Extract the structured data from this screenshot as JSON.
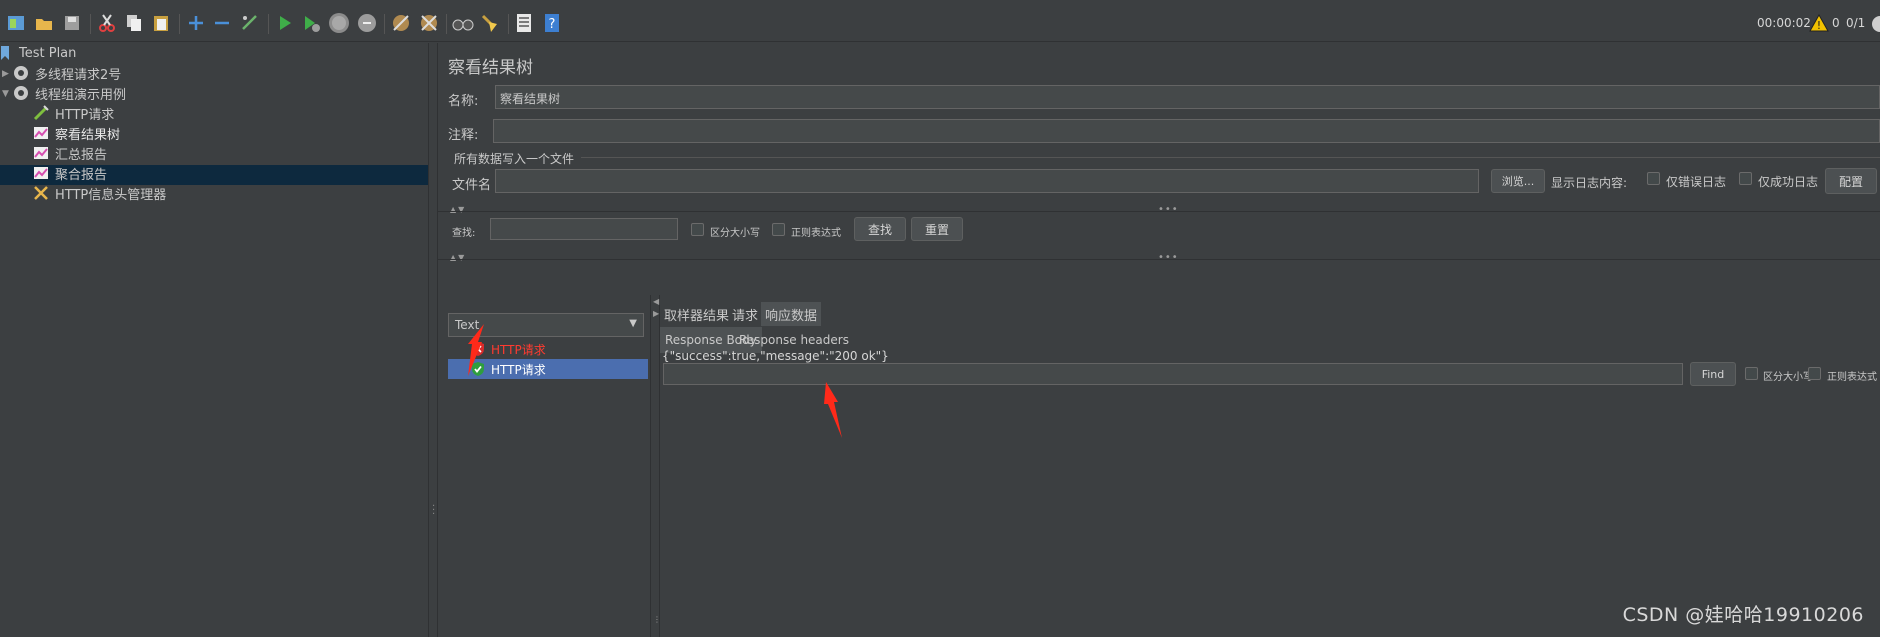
{
  "toolbar": {
    "timer": "00:00:02",
    "warning_count": "0",
    "threads": "0/1"
  },
  "tree": {
    "items": [
      {
        "label": "Test Plan",
        "icon": "test-plan-icon"
      },
      {
        "label": "多线程请求2号",
        "icon": "gear-icon"
      },
      {
        "label": "线程组演示用例",
        "icon": "gear-icon"
      },
      {
        "label": "HTTP请求",
        "icon": "pipette-icon"
      },
      {
        "label": "察看结果树",
        "icon": "chart-icon"
      },
      {
        "label": "汇总报告",
        "icon": "chart-icon"
      },
      {
        "label": "聚合报告",
        "icon": "chart-icon"
      },
      {
        "label": "HTTP信息头管理器",
        "icon": "wrench-icon"
      }
    ]
  },
  "panel": {
    "title": "察看结果树",
    "name_label": "名称:",
    "name_value": "察看结果树",
    "comment_label": "注释:",
    "comment_value": "",
    "write_all_label": "所有数据写入一个文件",
    "filename_label": "文件名",
    "filename_value": "",
    "browse_button": "浏览...",
    "log_content_label": "显示日志内容:",
    "errors_only_label": "仅错误日志",
    "success_only_label": "仅成功日志",
    "config_button": "配置"
  },
  "search": {
    "label": "查找:",
    "value": "",
    "case_sensitive_label": "区分大小写",
    "regex_label": "正则表达式",
    "find_button": "查找",
    "reset_button": "重置"
  },
  "results": {
    "renderer": "Text",
    "items": [
      {
        "label": "HTTP请求",
        "status": "fail"
      },
      {
        "label": "HTTP请求",
        "status": "success"
      }
    ]
  },
  "detail": {
    "tabs": [
      "取样器结果",
      "请求",
      "响应数据"
    ],
    "active_tab": "响应数据",
    "subtabs": [
      "Response Body",
      "Response headers"
    ],
    "active_subtab": "Response Body",
    "find_value": "",
    "find_button": "Find",
    "case_sensitive_label": "区分大小写",
    "regex_label": "正则表达式",
    "body": "{\"success\":true,\"message\":\"200 ok\"}"
  },
  "watermark": "CSDN @娃哈哈19910206",
  "colors": {
    "background": "#3c3f41",
    "selection": "#4b6eaf",
    "tree_selection": "#0d293e",
    "fail": "#ff3b30",
    "annotation_arrow": "#ff2a1a"
  }
}
